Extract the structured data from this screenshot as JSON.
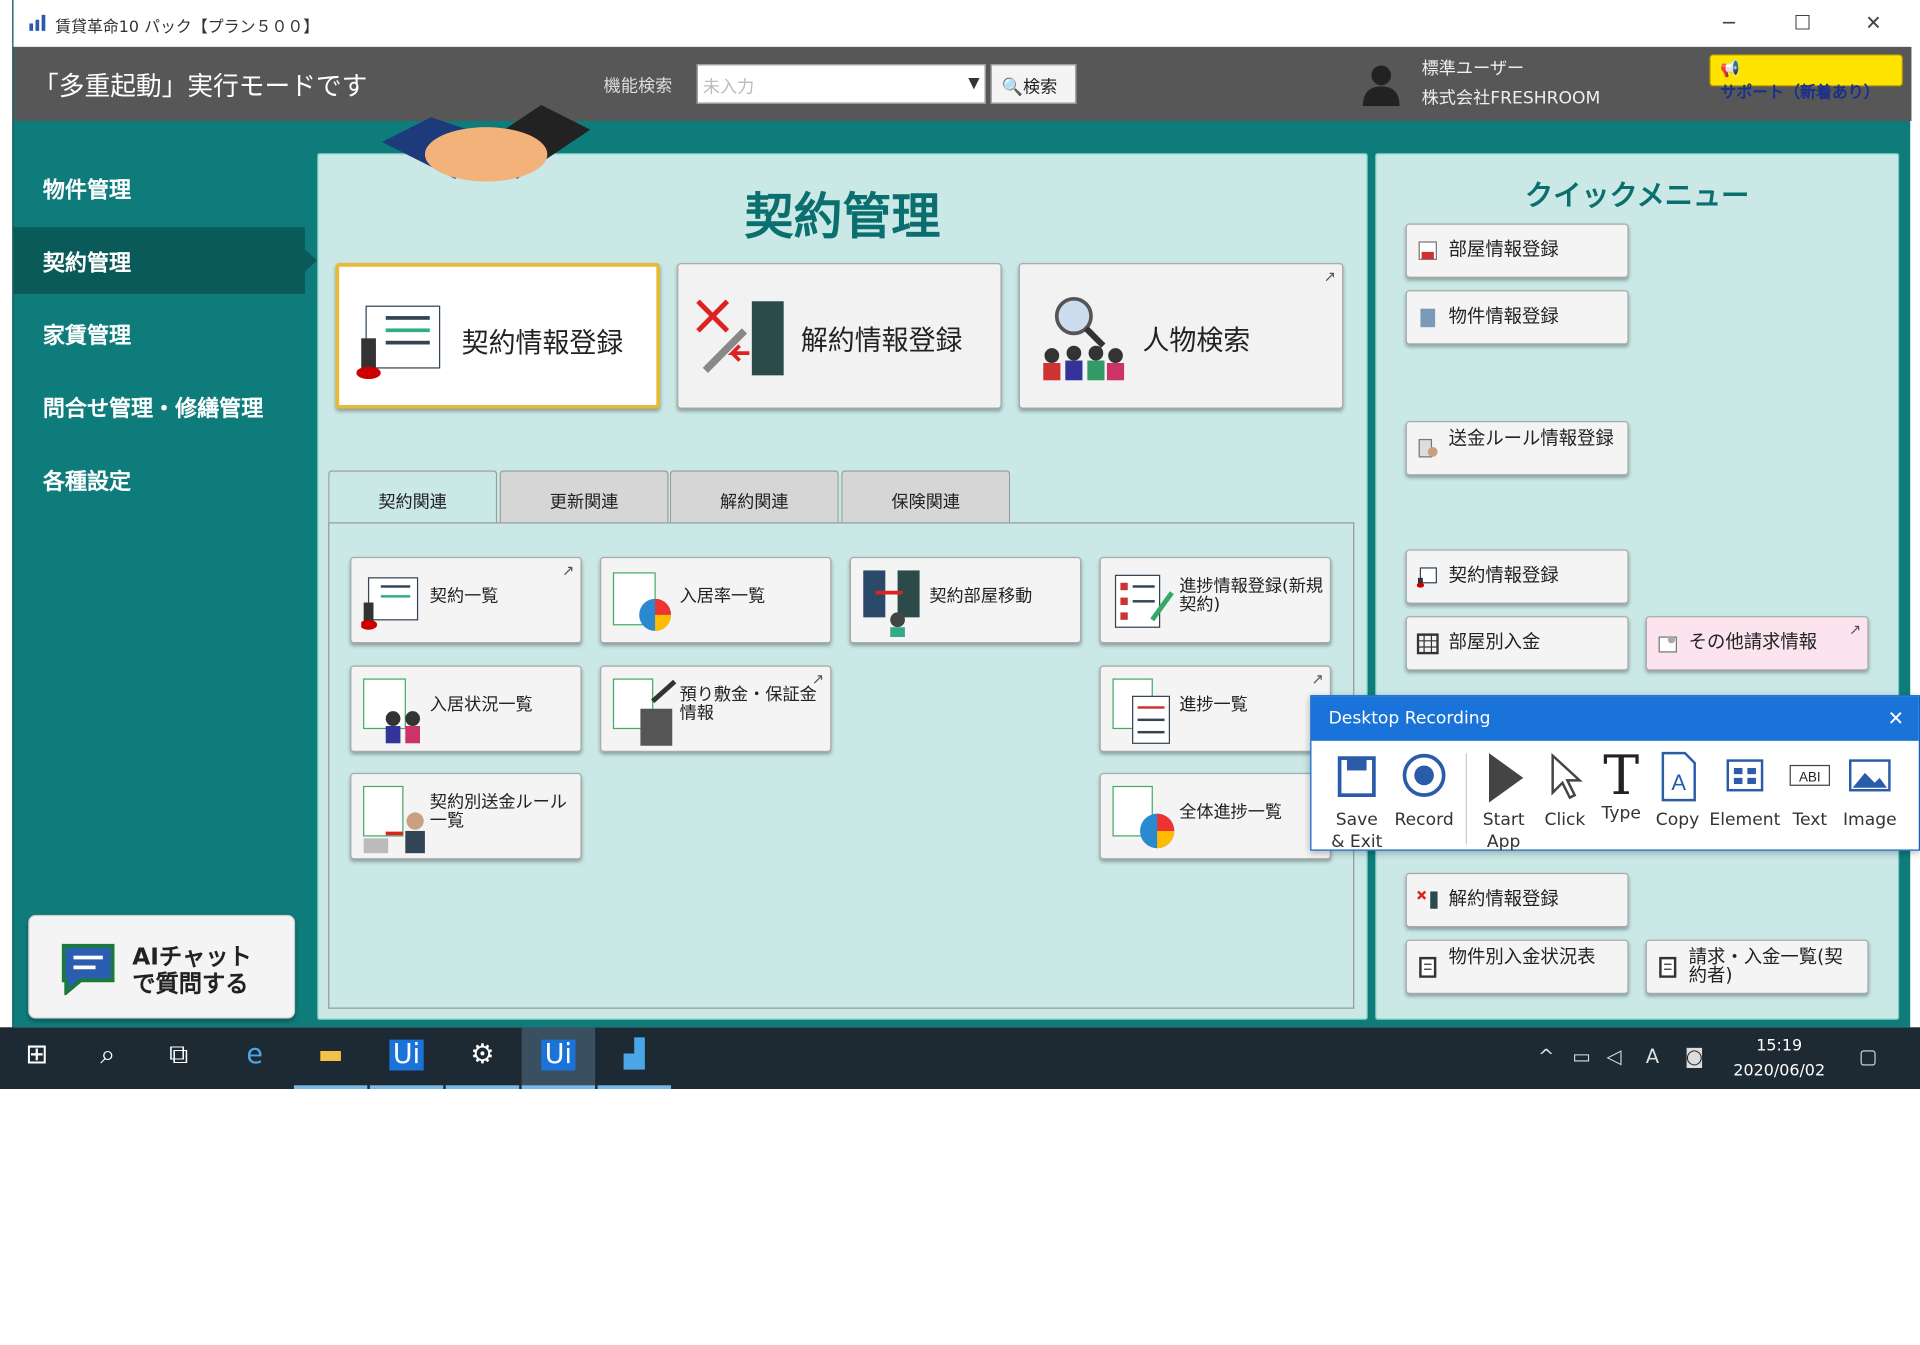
{
  "window": {
    "title": "賃貸革命10 パック【プラン５００】",
    "min": "─",
    "max": "☐",
    "close": "✕"
  },
  "header": {
    "mode_text": "「多重起動」実行モードです",
    "feature_search_label": "機能検索",
    "feature_search_placeholder": "未入力",
    "search_button": "検索",
    "user_line1": "標準ユーザー",
    "user_line2": "株式会社FRESHROOM",
    "support_button": "サポート（新着あり）"
  },
  "sidebar": {
    "items": [
      {
        "label": "物件管理"
      },
      {
        "label": "契約管理"
      },
      {
        "label": "家賃管理"
      },
      {
        "label": "問合せ管理・修繕管理"
      },
      {
        "label": "各種設定"
      }
    ],
    "active_index": 1,
    "ai_chat": "AIチャット\nで質問する"
  },
  "main": {
    "title": "契約管理",
    "big_buttons": [
      {
        "label": "契約情報登録"
      },
      {
        "label": "解約情報登録"
      },
      {
        "label": "人物検索"
      }
    ],
    "tabs": [
      {
        "label": "契約関連"
      },
      {
        "label": "更新関連"
      },
      {
        "label": "解約関連"
      },
      {
        "label": "保険関連"
      }
    ],
    "active_tab": 0,
    "small_buttons": [
      {
        "label": "契約一覧"
      },
      {
        "label": "入居率一覧"
      },
      {
        "label": "契約部屋移動"
      },
      {
        "label": "進捗情報登録(新規契約)"
      },
      {
        "label": "入居状況一覧"
      },
      {
        "label": "預り敷金・保証金情報"
      },
      {
        "label": "進捗一覧"
      },
      {
        "label": "契約別送金ルール一覧"
      },
      {
        "label": "全体進捗一覧"
      }
    ]
  },
  "quick_menu": {
    "title": "クイックメニュー",
    "items": [
      {
        "label": "部屋情報登録"
      },
      {
        "label": "物件情報登録"
      },
      {
        "label": "送金ルール情報登録"
      },
      {
        "label": "契約情報登録"
      },
      {
        "label": "部屋別入金"
      },
      {
        "label": "その他請求情報"
      },
      {
        "label": "解約情報登録"
      },
      {
        "label": "物件別入金状況表"
      },
      {
        "label": "請求・入金一覧(契約者)"
      }
    ]
  },
  "recorder": {
    "title": "Desktop Recording",
    "close": "✕",
    "tools": [
      {
        "label": "Save\n& Exit"
      },
      {
        "label": "Record"
      },
      {
        "label": "Start\nApp"
      },
      {
        "label": "Click"
      },
      {
        "label": "Type"
      },
      {
        "label": "Copy"
      },
      {
        "label": "Element"
      },
      {
        "label": "Text"
      },
      {
        "label": "Image"
      }
    ]
  },
  "taskbar": {
    "time": "15:19",
    "date": "2020/06/02",
    "apps": [
      "start-icon",
      "search-icon",
      "task-view-icon",
      "ie-icon",
      "file-explorer-icon",
      "uipath-studio-icon",
      "settings-icon",
      "uipath-robot-icon",
      "chintai-app-icon"
    ]
  },
  "colors": {
    "teal": "#0f7c7c",
    "panel": "#c9e8e6",
    "accent": "#1a73d9",
    "support": "#ffe400"
  }
}
